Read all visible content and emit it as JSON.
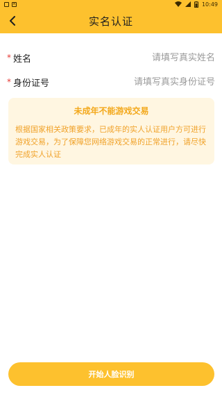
{
  "statusbar": {
    "time": "10:49",
    "left_icon_1": "image-icon",
    "left_icon_2": "a-icon"
  },
  "header": {
    "title": "实名认证",
    "back_icon": "chevron-left-icon"
  },
  "form": {
    "required_mark": "*",
    "name_label": "姓名",
    "name_placeholder": "请填写真实姓名",
    "id_label": "身份证号",
    "id_placeholder": "请填写真实身份证号"
  },
  "notice": {
    "title": "未成年不能游戏交易",
    "body": "根据国家相关政策要求，已成年的实人认证用户方可进行游戏交易，为了保障您网络游戏交易的正常进行，请尽快完成实人认证"
  },
  "button": {
    "label": "开始人脸识别"
  },
  "colors": {
    "brand": "#FDC12E",
    "notice_bg": "#FFF6E1",
    "notice_text": "#F3A81B",
    "required": "#E53935"
  }
}
